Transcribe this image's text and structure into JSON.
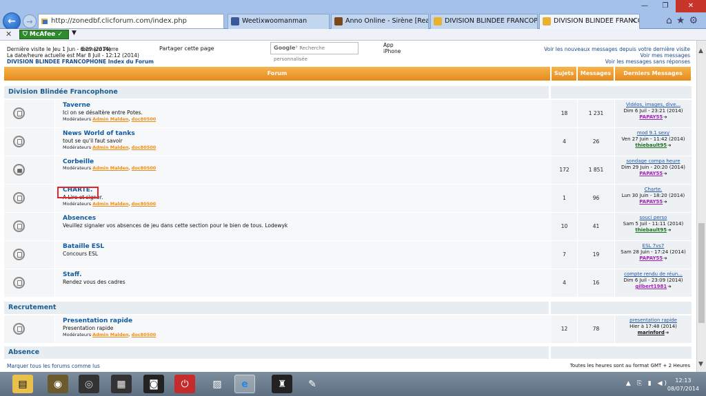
{
  "browser": {
    "url": "http://zonedbf.clicforum.com/index.php",
    "tabs": [
      {
        "label": "Weetixwoomanman"
      },
      {
        "label": "Anno Online - Sirène [Realm 1]"
      },
      {
        "label": "DIVISION BLINDEE FRANCOPH..."
      },
      {
        "label": "DIVISION BLINDEE FRANCO...",
        "active": true
      }
    ],
    "toolbar": {
      "mcafee": "McAfee"
    }
  },
  "header": {
    "last_visit": "Dernière visite le Jeu 1 Jun - 6:29 (2014)",
    "pseudo": "Bernard Pierre",
    "now": "La date/heure actuelle est Mar 8 Juil - 12:12 (2014)",
    "forum_index": "DIVISION BLINDEE FRANCOPHONE Index du Forum",
    "share": "Partager cette page",
    "google": "Recherche personnalisée",
    "app": [
      "App",
      "iPhone"
    ],
    "links": [
      "Voir les nouveaux messages depuis votre dernière visite",
      "Voir mes messages",
      "Voir les messages sans réponses"
    ]
  },
  "table": {
    "columns": {
      "forum": "Forum",
      "subjects": "Sujets",
      "messages": "Messages",
      "last": "Derniers Messages"
    },
    "mod_label": "Modérateurs",
    "moderators": [
      "Admin Malden",
      "doc80500"
    ],
    "categories": [
      {
        "name": "Division Blindée Francophone",
        "forums": [
          {
            "title": "Taverne",
            "desc": "Ici on se désaltère entre Potes.",
            "mods": true,
            "subjects": "18",
            "messages": "1 231",
            "last_title": "Vidéos, images, dive...",
            "last_date": "Dim 6 Juil - 23:21 (2014)",
            "last_user": "PAPAY55",
            "user_color": "#a023b8"
          },
          {
            "title": "News World of tanks",
            "desc": "tout se qu'il faut savoir",
            "mods": true,
            "subjects": "4",
            "messages": "26",
            "last_title": "mod 9.1 sexy",
            "last_date": "Ven 27 Juin - 11:42 (2014)",
            "last_user": "thiebault95",
            "user_color": "#1d6e1d"
          },
          {
            "title": "Corbeille",
            "desc": "",
            "mods": true,
            "lock": true,
            "subjects": "172",
            "messages": "1 851",
            "last_title": "sondage compa heure",
            "last_date": "Dim 29 Juin - 20:20 (2014)",
            "last_user": "PAPAY55",
            "user_color": "#a023b8"
          },
          {
            "title": "CHARTE.",
            "desc": "A Lire et signer.",
            "mods": true,
            "subjects": "1",
            "messages": "96",
            "last_title": "Charte.",
            "last_date": "Lun 30 Juin - 18:20 (2014)",
            "last_user": "PAPAY55",
            "user_color": "#a023b8"
          },
          {
            "title": "Absences",
            "desc": "Veuillez signaler vos absences de jeu dans cette section pour le bien de tous. Lodewyk",
            "mods": false,
            "subjects": "10",
            "messages": "41",
            "last_title": "souci perso",
            "last_date": "Sam 5 Juil - 11:11 (2014)",
            "last_user": "thiebault95",
            "user_color": "#1d6e1d"
          },
          {
            "title": "Bataille ESL",
            "desc": "Concours ESL",
            "mods": false,
            "subjects": "7",
            "messages": "19",
            "last_title": "ESL 7vs7",
            "last_date": "Sam 28 Juin - 17:24 (2014)",
            "last_user": "PAPAY55",
            "user_color": "#a023b8"
          },
          {
            "title": "Staff.",
            "desc": "Rendez vous des cadres",
            "mods": false,
            "subjects": "4",
            "messages": "16",
            "last_title": "compte rendu de réun...",
            "last_date": "Dim 6 Juil - 23:09 (2014)",
            "last_user": "gilbert1981",
            "user_color": "#a023b8"
          }
        ]
      },
      {
        "name": "Recrutement",
        "forums": [
          {
            "title": "Presentation rapide",
            "desc": "Presentation rapide",
            "mods": true,
            "subjects": "12",
            "messages": "78",
            "last_title": "presentation rapide",
            "last_date": "Hier à 17:48 (2014)",
            "last_user": "marinford",
            "user_color": "#111111"
          }
        ]
      },
      {
        "name": "Absence",
        "forums": []
      }
    ]
  },
  "footer": {
    "mark_read": "Marquer tous les forums comme lus",
    "timezone": "Toutes les heures sont au format GMT + 2 Heures"
  },
  "taskbar": {
    "time": "12:13",
    "date": "08/07/2014"
  }
}
